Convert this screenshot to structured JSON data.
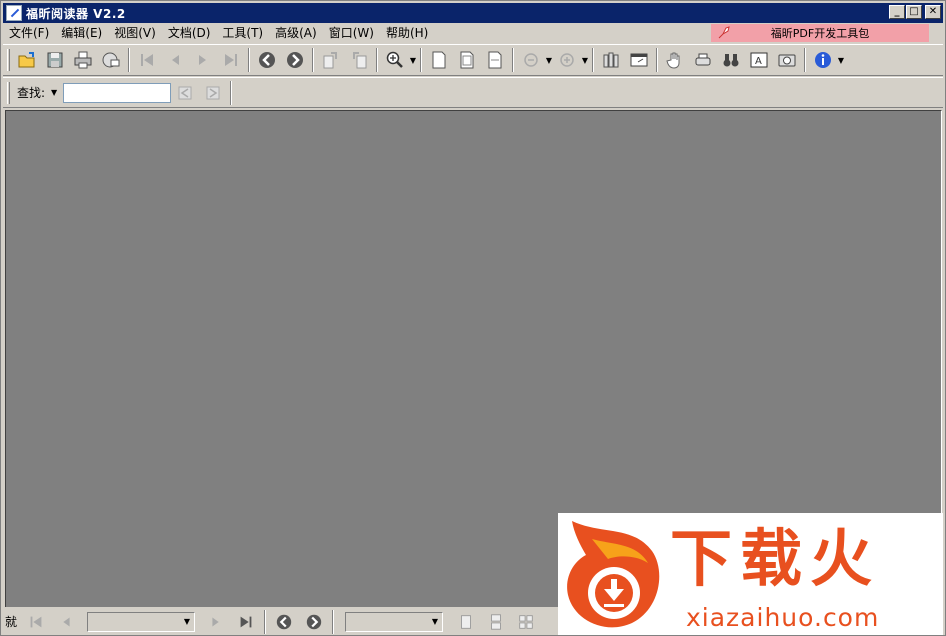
{
  "window": {
    "title": "福昕阅读器 V2.2",
    "minimize_glyph": "_",
    "maximize_glyph": "□",
    "close_glyph": "✕"
  },
  "menu": {
    "items": [
      {
        "label": "文件(F)"
      },
      {
        "label": "编辑(E)"
      },
      {
        "label": "视图(V)"
      },
      {
        "label": "文档(D)"
      },
      {
        "label": "工具(T)"
      },
      {
        "label": "高级(A)"
      },
      {
        "label": "窗口(W)"
      },
      {
        "label": "帮助(H)"
      }
    ],
    "promo_label": "福昕PDF开发工具包"
  },
  "toolbar1": {
    "icons": [
      "open-icon",
      "save-icon",
      "print-icon",
      "email-icon",
      "first-page-icon",
      "prev-page-icon",
      "next-page-icon",
      "last-page-icon",
      "back-icon",
      "forward-icon",
      "rotate-cw-icon",
      "rotate-ccw-icon",
      "zoom-icon",
      "actual-size-icon",
      "fit-page-icon",
      "fit-width-icon",
      "zoom-out-icon",
      "zoom-in-icon",
      "columns-icon",
      "window-icon",
      "hand-icon",
      "typewriter-icon",
      "find-icon",
      "text-select-icon",
      "snapshot-icon",
      "info-icon"
    ]
  },
  "search": {
    "label": "查找:",
    "value": "",
    "placeholder": ""
  },
  "statusbar": {
    "text": "就",
    "page_value": "",
    "zoom_value": ""
  },
  "watermark": {
    "brand": "下载火",
    "url": "xiazaihuo.com",
    "color": "#e8501f"
  },
  "colors": {
    "titlebar": "#0a246a",
    "document_bg": "#808080",
    "chrome": "#d4d0c8",
    "promo_bg": "#f2a0a8"
  }
}
